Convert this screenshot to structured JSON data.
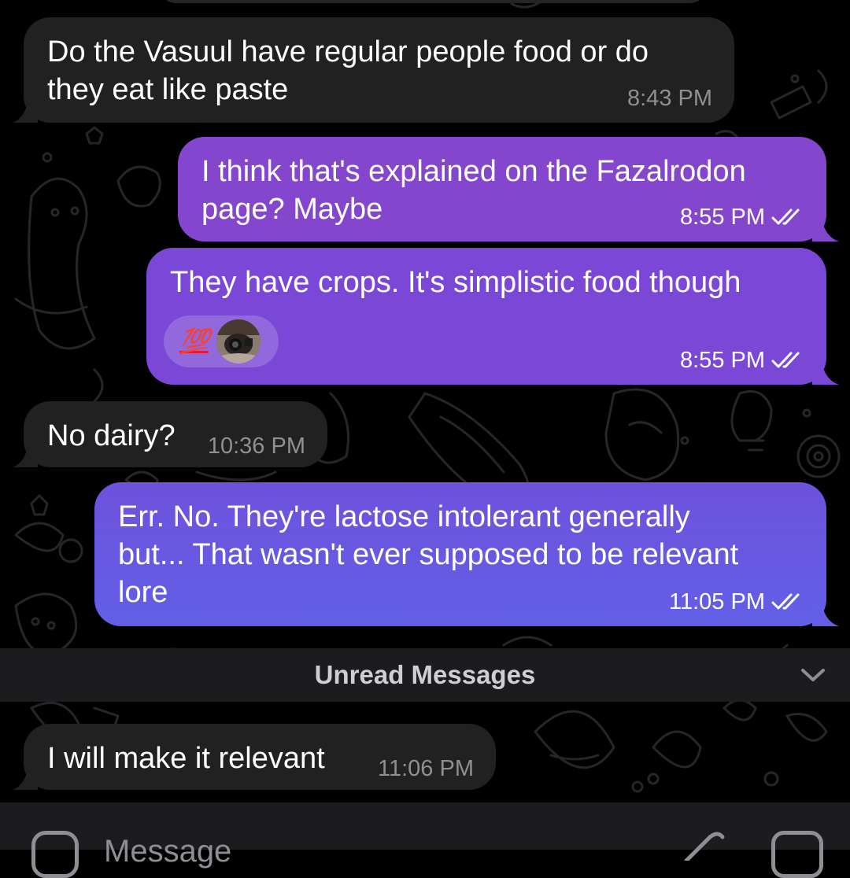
{
  "messages": [
    {
      "direction": "incoming",
      "text": "Do the Vasuul have regular people food or do\nthey eat like paste",
      "time": "8:43 PM"
    },
    {
      "direction": "outgoing",
      "text": "I think that's explained on the Fazalrodon\npage? Maybe",
      "time": "8:55 PM",
      "status_icon": "double-check-icon"
    },
    {
      "direction": "outgoing",
      "text": "They have crops. It's simplistic food though",
      "time": "8:55 PM",
      "status_icon": "double-check-icon",
      "reaction_emoji": "💯"
    },
    {
      "direction": "incoming",
      "text": "No dairy?",
      "time": "10:36 PM"
    },
    {
      "direction": "outgoing",
      "text": "Err. No. They're lactose intolerant generally\nbut... That wasn't ever supposed to be relevant\nlore",
      "time": "11:05 PM",
      "status_icon": "double-check-icon"
    },
    {
      "direction": "incoming",
      "text": "I will make it relevant",
      "time": "11:06 PM"
    }
  ],
  "unread_divider": {
    "label": "Unread Messages"
  },
  "composer": {
    "placeholder": "Message"
  },
  "colors": {
    "background": "#000000",
    "incoming_bubble": "#212121",
    "outgoing_bubble_top": "#8b46d0",
    "outgoing_bubble_bottom": "#6a5ce6",
    "timestamp_incoming": "#8f8f94",
    "unread_bar": "#1c1c1e"
  }
}
